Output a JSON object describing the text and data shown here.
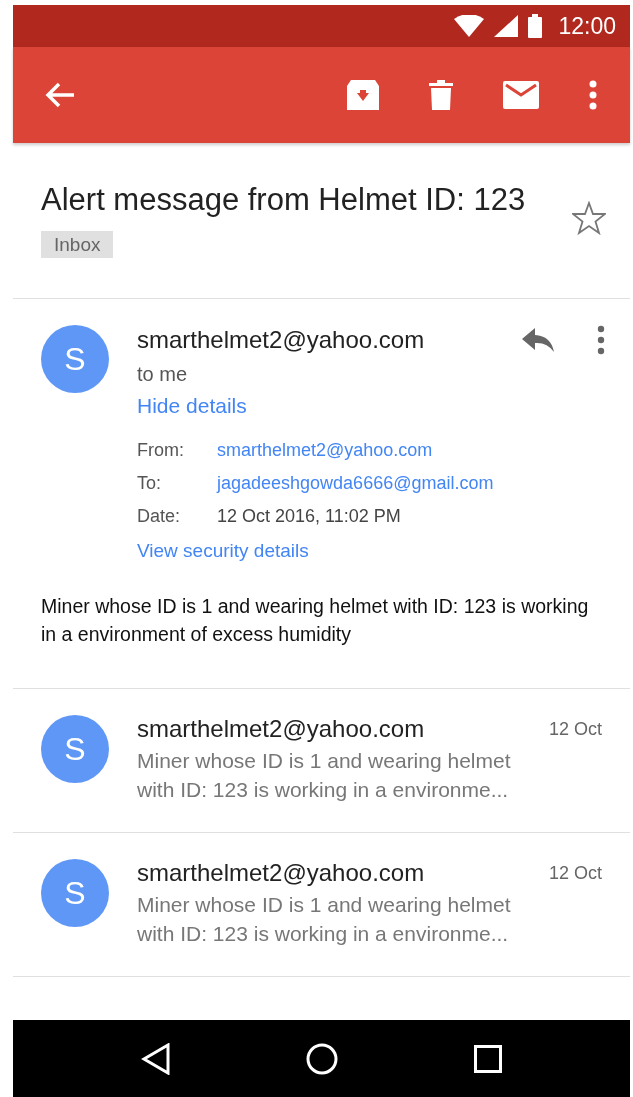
{
  "status_bar": {
    "time": "12:00"
  },
  "subject": "Alert message from Helmet ID: 123",
  "label": "Inbox",
  "starred": false,
  "message": {
    "avatar": "S",
    "sender": "smarthelmet2@yahoo.com",
    "recipient": "to me",
    "toggle": "Hide details",
    "details": [
      {
        "label": "From:",
        "value": "smarthelmet2@yahoo.com",
        "kind": "link"
      },
      {
        "label": "To:",
        "value": "jagadeeshgowda6666@gmail.com",
        "kind": "link"
      },
      {
        "label": "Date:",
        "value": "12 Oct 2016, 11:02 PM",
        "kind": "text"
      }
    ],
    "security_link": "View security details",
    "body": "Miner whose ID is 1 and wearing helmet with ID: 123 is working in a environment of excess humidity"
  },
  "thread": [
    {
      "avatar": "S",
      "sender": "smarthelmet2@yahoo.com",
      "date": "12 Oct",
      "snippet_lines": [
        "Miner whose ID is 1 and wearing helmet",
        "with ID: 123 is working in a environme..."
      ]
    },
    {
      "avatar": "S",
      "sender": "smarthelmet2@yahoo.com",
      "date": "12 Oct",
      "snippet_lines": [
        "Miner whose ID is 1 and wearing helmet",
        "with ID: 123 is working in a environme..."
      ]
    }
  ]
}
